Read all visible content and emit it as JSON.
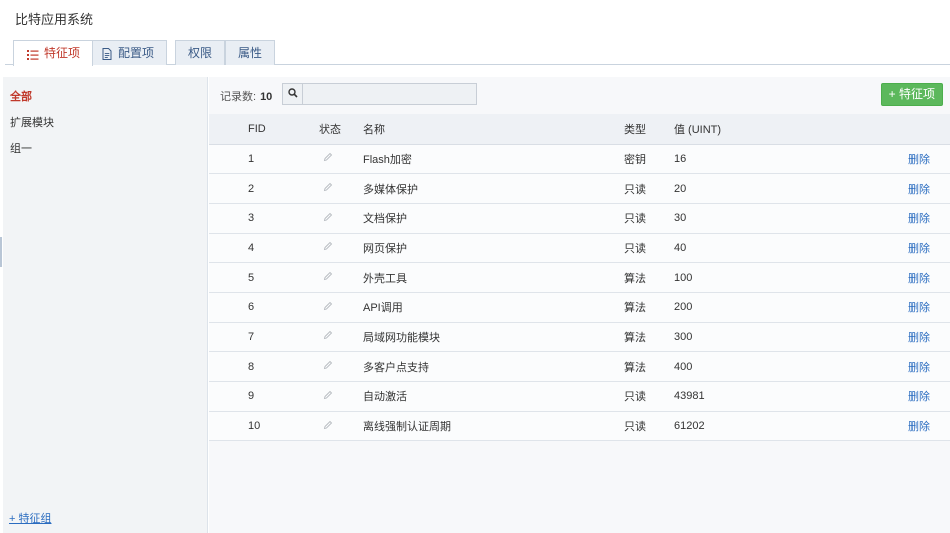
{
  "app": {
    "title": "比特应用系统"
  },
  "tabs": [
    {
      "label": "特征项",
      "icon": "list-icon",
      "active": true
    },
    {
      "label": "配置项",
      "icon": "document-icon",
      "active": false
    },
    {
      "label": "权限",
      "active": false
    },
    {
      "label": "属性",
      "active": false
    }
  ],
  "sidebar": {
    "items": [
      {
        "label": "全部",
        "active": true
      },
      {
        "label": "扩展模块",
        "active": false
      },
      {
        "label": "组一",
        "active": false
      }
    ],
    "add_group": "+ 特征组"
  },
  "toolbar": {
    "record_label": "记录数:",
    "record_count": "10",
    "search_placeholder": "",
    "add_label": "+ 特征项"
  },
  "table": {
    "headers": {
      "fid": "FID",
      "state": "状态",
      "name": "名称",
      "type": "类型",
      "value": "值 (UINT)"
    },
    "delete_label": "删除",
    "rows": [
      {
        "fid": "1",
        "name": "Flash加密",
        "type": "密钥",
        "value": "16",
        "value_link": true
      },
      {
        "fid": "2",
        "name": "多媒体保护",
        "type": "只读",
        "value": "20",
        "value_link": true
      },
      {
        "fid": "3",
        "name": "文档保护",
        "type": "只读",
        "value": "30",
        "value_link": false
      },
      {
        "fid": "4",
        "name": "网页保护",
        "type": "只读",
        "value": "40",
        "value_link": false
      },
      {
        "fid": "5",
        "name": "外壳工具",
        "type": "算法",
        "value": "100",
        "value_link": true
      },
      {
        "fid": "6",
        "name": "API调用",
        "type": "算法",
        "value": "200",
        "value_link": true
      },
      {
        "fid": "7",
        "name": "局域网功能模块",
        "type": "算法",
        "value": "300",
        "value_link": true
      },
      {
        "fid": "8",
        "name": "多客户点支持",
        "type": "算法",
        "value": "400",
        "value_link": true
      },
      {
        "fid": "9",
        "name": "自动激活",
        "type": "只读",
        "value": "43981",
        "value_link": true
      },
      {
        "fid": "10",
        "name": "离线强制认证周期",
        "type": "只读",
        "value": "61202",
        "value_link": true
      }
    ]
  },
  "colors": {
    "active_red": "#c0392b",
    "link_blue": "#2a7fd4",
    "add_green": "#5cb85c"
  }
}
